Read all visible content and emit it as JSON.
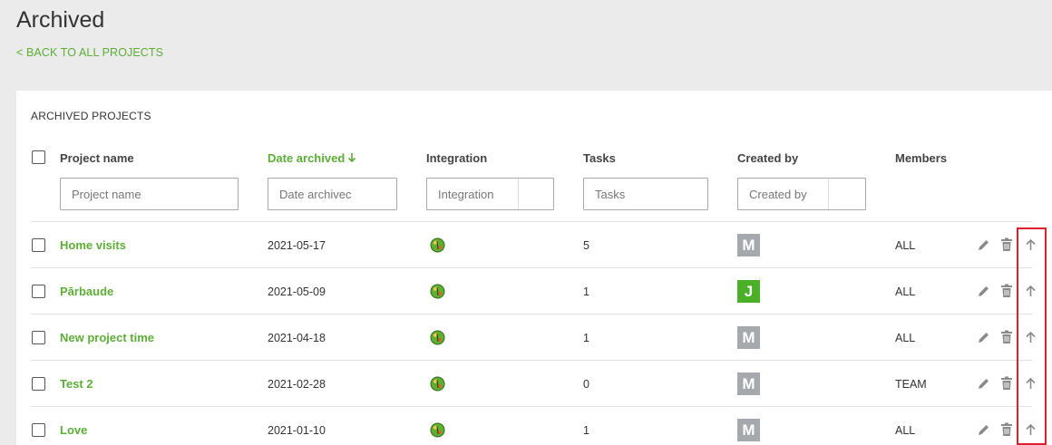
{
  "page": {
    "title": "Archived",
    "back_link": "< BACK TO ALL PROJECTS"
  },
  "panel": {
    "title": "ARCHIVED PROJECTS"
  },
  "columns": {
    "project_name": "Project name",
    "date_archived": "Date archived",
    "integration": "Integration",
    "tasks": "Tasks",
    "created_by": "Created by",
    "members": "Members"
  },
  "filters": {
    "project_name": "Project name",
    "date_archived": "Date archivec",
    "integration": "Integration",
    "tasks": "Tasks",
    "created_by": "Created by"
  },
  "colors": {
    "accent": "#5cae36",
    "avatar_gray": "#a5a9ad",
    "avatar_green": "#4caf28",
    "highlight": "#e0202a"
  },
  "rows": [
    {
      "name": "Home visits",
      "date": "2021-05-17",
      "integration_icon": "globe-icon",
      "tasks": "5",
      "creator_initial": "M",
      "creator_color": "#a5a9ad",
      "members": "ALL"
    },
    {
      "name": "Pārbaude",
      "date": "2021-05-09",
      "integration_icon": "globe-icon",
      "tasks": "1",
      "creator_initial": "J",
      "creator_color": "#4caf28",
      "members": "ALL"
    },
    {
      "name": "New project time",
      "date": "2021-04-18",
      "integration_icon": "globe-icon",
      "tasks": "1",
      "creator_initial": "M",
      "creator_color": "#a5a9ad",
      "members": "ALL"
    },
    {
      "name": "Test 2",
      "date": "2021-02-28",
      "integration_icon": "globe-icon",
      "tasks": "0",
      "creator_initial": "M",
      "creator_color": "#a5a9ad",
      "members": "TEAM"
    },
    {
      "name": "Love",
      "date": "2021-01-10",
      "integration_icon": "globe-icon",
      "tasks": "1",
      "creator_initial": "M",
      "creator_color": "#a5a9ad",
      "members": "ALL"
    }
  ],
  "row_actions": [
    "pencil-icon",
    "trash-icon",
    "arrow-up-icon"
  ]
}
